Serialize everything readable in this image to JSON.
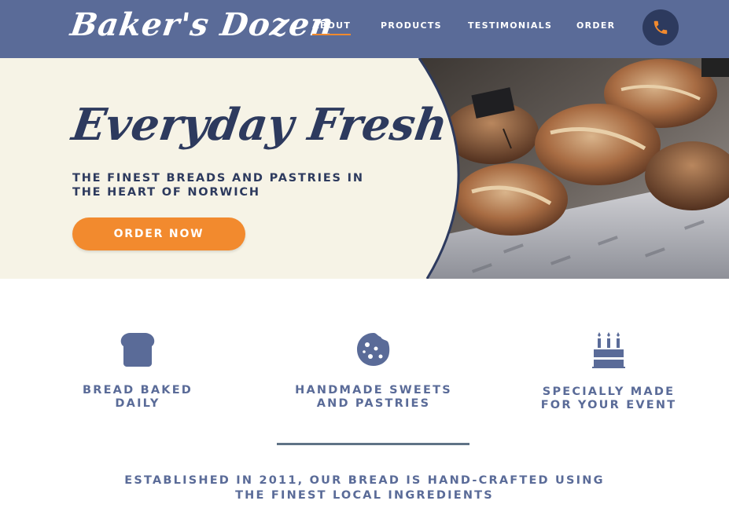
{
  "brand": {
    "name": "Baker's Dozen"
  },
  "nav": {
    "items": [
      {
        "label": "ABOUT",
        "active": true
      },
      {
        "label": "PRODUCTS",
        "active": false
      },
      {
        "label": "TESTIMONIALS",
        "active": false
      },
      {
        "label": "ORDER",
        "active": false
      }
    ],
    "phone_icon": "phone-icon"
  },
  "hero": {
    "title": "Everyday Fresh",
    "subtitle": "THE FINEST BREADS AND PASTRIES IN THE HEART OF NORWICH",
    "cta_label": "ORDER NOW",
    "image_subject": "bread-loaves-photo"
  },
  "features": [
    {
      "icon": "bread-icon",
      "label": "BREAD BAKED\nDAILY"
    },
    {
      "icon": "cookie-icon",
      "label": "HANDMADE SWEETS\nAND PASTRIES"
    },
    {
      "icon": "cake-icon",
      "label": "SPECIALLY MADE\nFOR YOUR EVENT"
    }
  ],
  "established_text": "ESTABLISHED IN 2011, OUR BREAD IS HAND-CRAFTED USING THE FINEST LOCAL INGREDIENTS",
  "colors": {
    "nav_bg": "#5a6b98",
    "accent": "#f28a2e",
    "dark_navy": "#2d3a5e",
    "hero_bg": "#f6f3e6",
    "divider": "#5f7386"
  }
}
